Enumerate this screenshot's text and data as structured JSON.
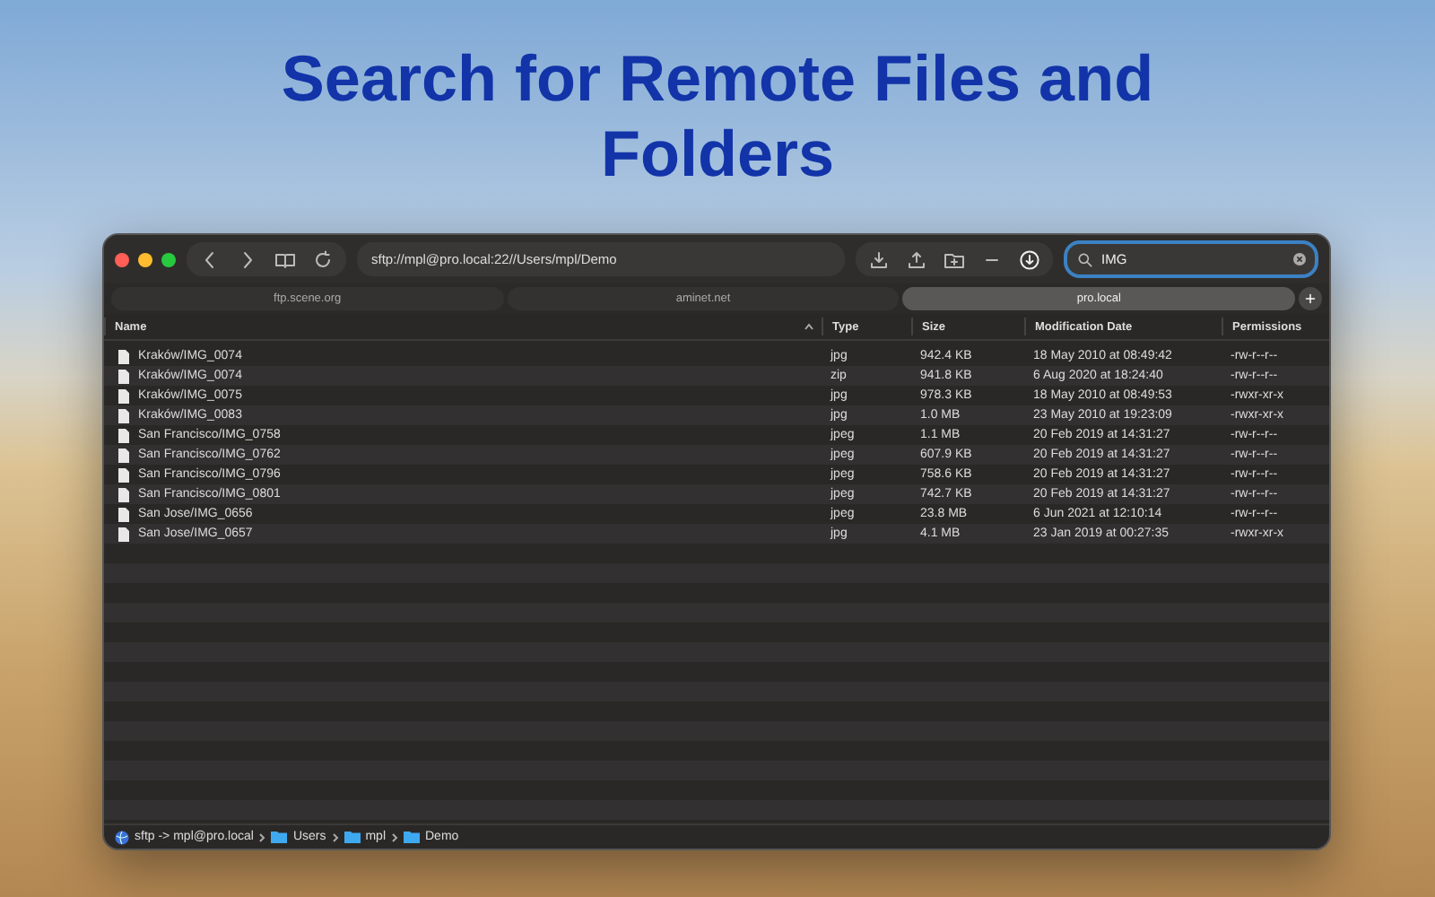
{
  "headline": "Search for Remote Files and Folders",
  "window": {
    "address": "sftp://mpl@pro.local:22//Users/mpl/Demo",
    "search": {
      "value": "IMG"
    }
  },
  "tabs": [
    {
      "label": "ftp.scene.org",
      "selected": false
    },
    {
      "label": "aminet.net",
      "selected": false
    },
    {
      "label": "pro.local",
      "selected": true
    }
  ],
  "table": {
    "columns": [
      "Name",
      "Type",
      "Size",
      "Modification Date",
      "Permissions"
    ],
    "rows": [
      {
        "name": "Kraków/IMG_0074",
        "type": "jpg",
        "size": "942.4 KB",
        "date": "18 May 2010 at 08:49:42",
        "permissions": "-rw-r--r--"
      },
      {
        "name": "Kraków/IMG_0074",
        "type": "zip",
        "size": "941.8 KB",
        "date": "6 Aug 2020 at 18:24:40",
        "permissions": "-rw-r--r--"
      },
      {
        "name": "Kraków/IMG_0075",
        "type": "jpg",
        "size": "978.3 KB",
        "date": "18 May 2010 at 08:49:53",
        "permissions": "-rwxr-xr-x"
      },
      {
        "name": "Kraków/IMG_0083",
        "type": "jpg",
        "size": "1.0 MB",
        "date": "23 May 2010 at 19:23:09",
        "permissions": "-rwxr-xr-x"
      },
      {
        "name": "San Francisco/IMG_0758",
        "type": "jpeg",
        "size": "1.1 MB",
        "date": "20 Feb 2019 at 14:31:27",
        "permissions": "-rw-r--r--"
      },
      {
        "name": "San Francisco/IMG_0762",
        "type": "jpeg",
        "size": "607.9 KB",
        "date": "20 Feb 2019 at 14:31:27",
        "permissions": "-rw-r--r--"
      },
      {
        "name": "San Francisco/IMG_0796",
        "type": "jpeg",
        "size": "758.6 KB",
        "date": "20 Feb 2019 at 14:31:27",
        "permissions": "-rw-r--r--"
      },
      {
        "name": "San Francisco/IMG_0801",
        "type": "jpeg",
        "size": "742.7 KB",
        "date": "20 Feb 2019 at 14:31:27",
        "permissions": "-rw-r--r--"
      },
      {
        "name": "San Jose/IMG_0656",
        "type": "jpeg",
        "size": "23.8 MB",
        "date": "6 Jun 2021 at 12:10:14",
        "permissions": "-rw-r--r--"
      },
      {
        "name": "San Jose/IMG_0657",
        "type": "jpg",
        "size": "4.1 MB",
        "date": "23 Jan 2019 at 00:27:35",
        "permissions": "-rwxr-xr-x"
      }
    ]
  },
  "status_bar": {
    "path": [
      {
        "kind": "server",
        "label": "sftp -> mpl@pro.local"
      },
      {
        "kind": "folder",
        "label": "Users"
      },
      {
        "kind": "folder",
        "label": "mpl"
      },
      {
        "kind": "folder",
        "label": "Demo"
      }
    ]
  }
}
